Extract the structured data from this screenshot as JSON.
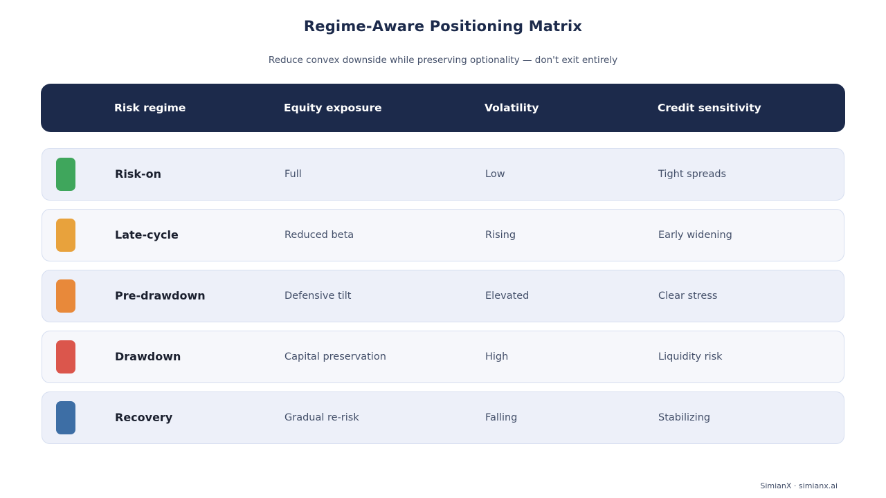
{
  "title": "Regime-Aware Positioning Matrix",
  "subtitle": "Reduce convex downside while preserving optionality — don't exit entirely",
  "header": {
    "col1": "Risk regime",
    "col2": "Equity exposure",
    "col3": "Volatility",
    "col4": "Credit sensitivity"
  },
  "rows": [
    {
      "regime": "Risk-on",
      "equity": "Full",
      "volatility": "Low",
      "credit": "Tight spreads",
      "color": "#3fa65c"
    },
    {
      "regime": "Late-cycle",
      "equity": "Reduced beta",
      "volatility": "Rising",
      "credit": "Early widening",
      "color": "#e8a23c"
    },
    {
      "regime": "Pre-drawdown",
      "equity": "Defensive tilt",
      "volatility": "Elevated",
      "credit": "Clear stress",
      "color": "#e8893a"
    },
    {
      "regime": "Drawdown",
      "equity": "Capital preservation",
      "volatility": "High",
      "credit": "Liquidity risk",
      "color": "#db564c"
    },
    {
      "regime": "Recovery",
      "equity": "Gradual re-risk",
      "volatility": "Falling",
      "credit": "Stabilizing",
      "color": "#3d6ea5"
    }
  ],
  "footer": "SimianX · simianx.ai"
}
